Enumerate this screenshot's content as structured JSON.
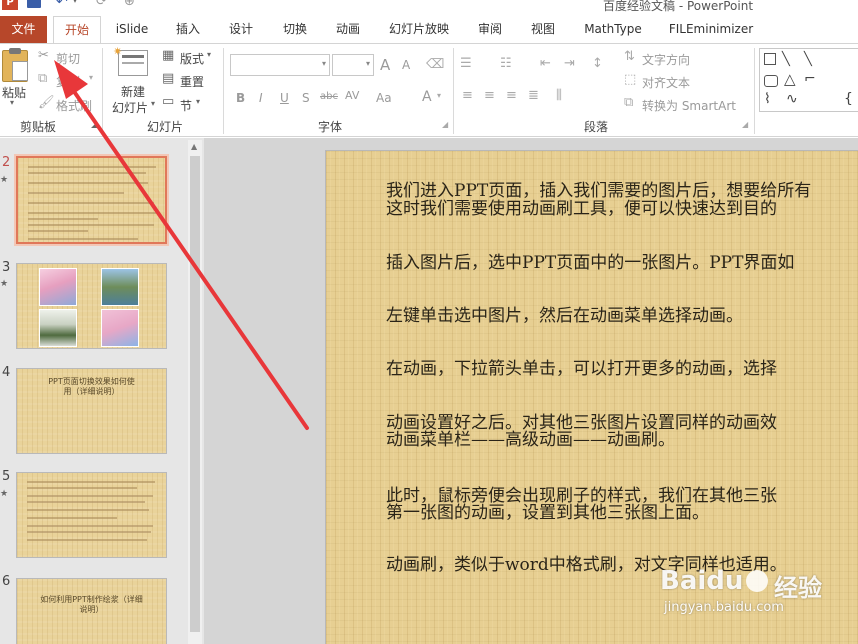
{
  "window": {
    "title": "百度经验文稿 - PowerPoint"
  },
  "tabs": {
    "file": "文件",
    "items": [
      "开始",
      "iSlide",
      "插入",
      "设计",
      "切换",
      "动画",
      "幻灯片放映",
      "审阅",
      "视图",
      "MathType",
      "FILEminimizer"
    ]
  },
  "ribbon": {
    "clipboard": {
      "paste": "粘贴",
      "cut": "剪切",
      "copy": "复制",
      "format_painter": "格式刷",
      "label": "剪贴板"
    },
    "slides": {
      "new_slide_line1": "新建",
      "new_slide_line2": "幻灯片",
      "layout": "版式",
      "reset": "重置",
      "section": "节",
      "label": "幻灯片"
    },
    "font": {
      "bold": "B",
      "italic": "I",
      "underline": "U",
      "shadow": "S",
      "strike": "abc",
      "spacing": "AV",
      "case": "Aa",
      "color": "A",
      "grow": "A",
      "shrink": "A",
      "label": "字体"
    },
    "paragraph": {
      "text_direction": "文字方向",
      "align_text": "对齐文本",
      "smartart": "转换为 SmartArt",
      "label": "段落"
    }
  },
  "slides_pane": {
    "items": [
      {
        "number": "2",
        "selected": true
      },
      {
        "number": "3",
        "selected": false
      },
      {
        "number": "4",
        "selected": false,
        "caption": "PPT页面切换效果如何使用（详细说明）"
      },
      {
        "number": "5",
        "selected": false
      },
      {
        "number": "6",
        "selected": false,
        "caption": "如何利用PPT制作绘浆（详细说明）"
      }
    ]
  },
  "slide": {
    "lines": [
      "我们进入PPT页面，插入我们需要的图片后，想要给所有",
      "这时我们需要使用动画刷工具，便可以快速达到目的",
      "插入图片后，选中PPT页面中的一张图片。PPT界面如",
      "左键单击选中图片，然后在动画菜单选择动画。",
      "在动画，下拉箭头单击，可以打开更多的动画，选择",
      "动画设置好之后。对其他三张图片设置同样的动画效",
      "动画菜单栏——高级动画——动画刷。",
      "此时，鼠标旁便会出现刷子的样式，我们在其他三张",
      "第一张图的动画，设置到其他三张图上面。",
      "动画刷，类似于word中格式刷，对文字同样也适用。"
    ]
  },
  "watermark": {
    "brand": "Baidu",
    "cn": "经验",
    "url": "jingyan.baidu.com"
  },
  "colors": {
    "accent": "#b7472a",
    "arrow": "#e8373a",
    "slide_bg": "#e7cf92"
  }
}
